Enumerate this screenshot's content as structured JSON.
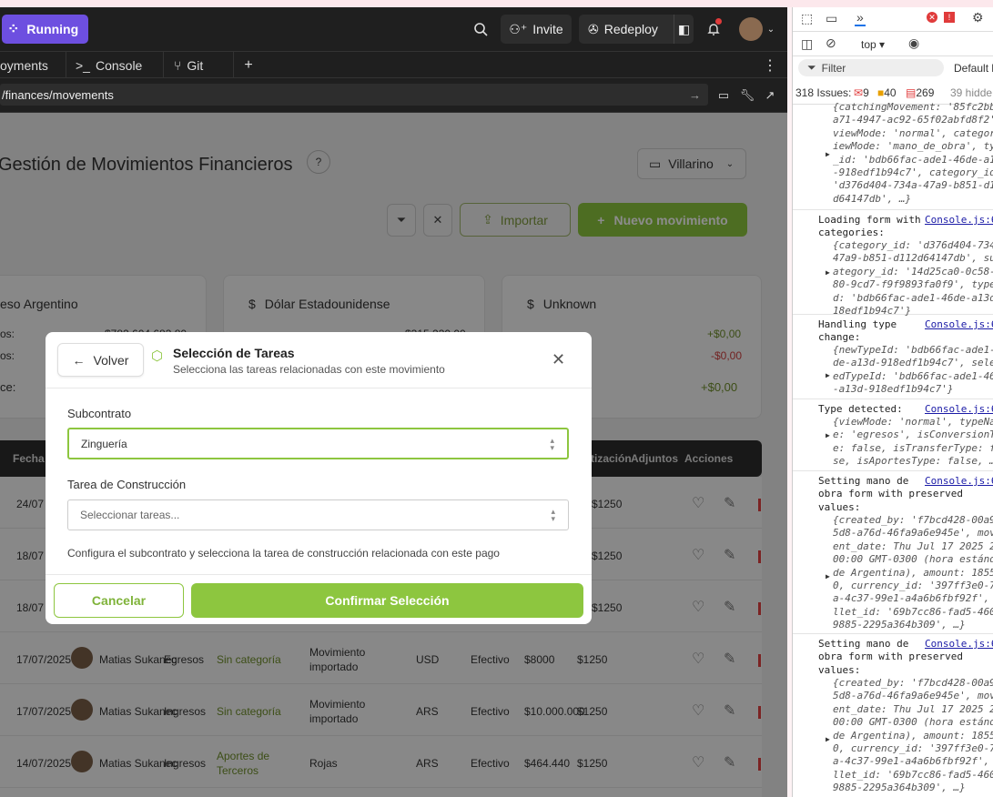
{
  "topbar": {
    "status": "Running",
    "invite": "Invite",
    "redeploy": "Redeploy"
  },
  "tabs": [
    {
      "label": "oyments"
    },
    {
      "label": "Console",
      "prefix": ">_"
    },
    {
      "label": "Git"
    }
  ],
  "url": "/finances/movements",
  "page": {
    "title": "Gestión de Movimientos Financieros",
    "project": "Villarino",
    "import": "Importar",
    "new": "Nuevo movimiento"
  },
  "cards": [
    {
      "title": "eso Argentino",
      "r1_label": "os:",
      "r1_value": "$782.604.683,80",
      "r2_label": "os:",
      "r3_label": "ce:"
    },
    {
      "title": "Dólar Estadounidense",
      "r1_value": "$315.230,00"
    },
    {
      "title": "Unknown",
      "r1_value": "+$0,00",
      "r2_value": "-$0,00",
      "r3_value": "+$0,00"
    }
  ],
  "table": {
    "headers": [
      "Fecha",
      "tización",
      "Adjuntos",
      "Acciones"
    ],
    "rows": [
      {
        "date": "24/07"
      },
      {
        "date": "18/07"
      },
      {
        "date": "18/07"
      },
      {
        "date": "17/07/2025",
        "user": "Matias Sukanec",
        "type": "Egresos",
        "category": "Sin categoría",
        "description": "Movimiento importado",
        "currency": "USD",
        "wallet": "Efectivo",
        "amount": "$8000",
        "rate": "$1250"
      },
      {
        "date": "17/07/2025",
        "user": "Matias Sukanec",
        "type": "Ingresos",
        "category": "Sin categoría",
        "description": "Movimiento importado",
        "currency": "ARS",
        "wallet": "Efectivo",
        "amount": "$10.000.000",
        "rate": "$1250"
      },
      {
        "date": "14/07/2025",
        "user": "Matias Sukanec",
        "type": "Ingresos",
        "category": "Aportes de Terceros",
        "description": "Rojas",
        "currency": "ARS",
        "wallet": "Efectivo",
        "amount": "$464.440",
        "rate": "$1250"
      }
    ],
    "partial_rates": [
      "$1250",
      "$1250",
      "$1250"
    ]
  },
  "modal": {
    "back": "Volver",
    "title": "Selección de Tareas",
    "subtitle": "Selecciona las tareas relacionadas con este movimiento",
    "subcontract_label": "Subcontrato",
    "subcontract_value": "Zinguería",
    "task_label": "Tarea de Construcción",
    "task_placeholder": "Seleccionar tareas...",
    "hint": "Configura el subcontrato y selecciona la tarea de construcción relacionada con este pago",
    "cancel": "Cancelar",
    "confirm": "Confirmar Selección"
  },
  "devtools": {
    "context": "top",
    "filter": "Filter",
    "levels": "Default l",
    "issues_label": "318 Issues:",
    "errors": "9",
    "warnings": "40",
    "info": "269",
    "hidden": "39 hidde",
    "src": "Console.js:6",
    "log0": "{catchingMovement: '85fc2bbb-\na71-4947-ac92-65f02abfd8f2'\nviewMode: 'normal', categor\niewMode: 'mano_de_obra', ty\n_id: 'bdb66fac-ade1-46de-a1\n-918edf1b94c7', category_id\n'd376d404-734a-47a9-b851-d1\nd64147db', …}",
    "log1_msg": "Loading form with\ncategories:",
    "log1_obj": "{category_id: 'd376d404-734\n47a9-b851-d112d64147db', su\nategory_id: '14d25ca0-0c58-\n80-9cd7-f9f9893fa0f9', type\nd: 'bdb66fac-ade1-46de-a13d\n18edf1b94c7'}",
    "log2_msg": "Handling type\nchange:",
    "log2_obj": "{newTypeId: 'bdb66fac-ade1-\nde-a13d-918edf1b94c7', sele\nedTypeId: 'bdb66fac-ade1-46\n-a13d-918edf1b94c7'}",
    "log3_msg": "Type detected:",
    "log3_obj": "{viewMode: 'normal', typeNa\ne: 'egresos', isConversionT\ne: false, isTransferType: f\nse, isAportesType: false, …",
    "log4_msg": "Setting mano de\nobra form with preserved\nvalues:",
    "log4_obj": "{created_by: 'f7bcd428-00a9\n5d8-a76d-46fa9a6e945e', mov\nent_date: Thu Jul 17 2025 2\n00:00 GMT-0300 (hora estánd\nde Argentina), amount: 1855\n0, currency_id: '397ff3e0-7\na-4c37-99e1-a4a6b6fbf92f',\nllet_id: '69b7cc86-fad5-460\n9885-2295a364b309', …}",
    "log5_msg": "Setting mano de\nobra form with preserved\nvalues:",
    "log5_obj": "{created_by: 'f7bcd428-00a9\n5d8-a76d-46fa9a6e945e', mov\nent_date: Thu Jul 17 2025 2\n00:00 GMT-0300 (hora estánd\nde Argentina), amount: 1855\n0, currency_id: '397ff3e0-7\na-4c37-99e1-a4a6b6fbf92f',\nllet_id: '69b7cc86-fad5-460\n9885-2295a364b309', …}"
  },
  "colors": {
    "accent": "#8dc63f",
    "running": "#6d4fe0",
    "error": "#e03b3b"
  }
}
